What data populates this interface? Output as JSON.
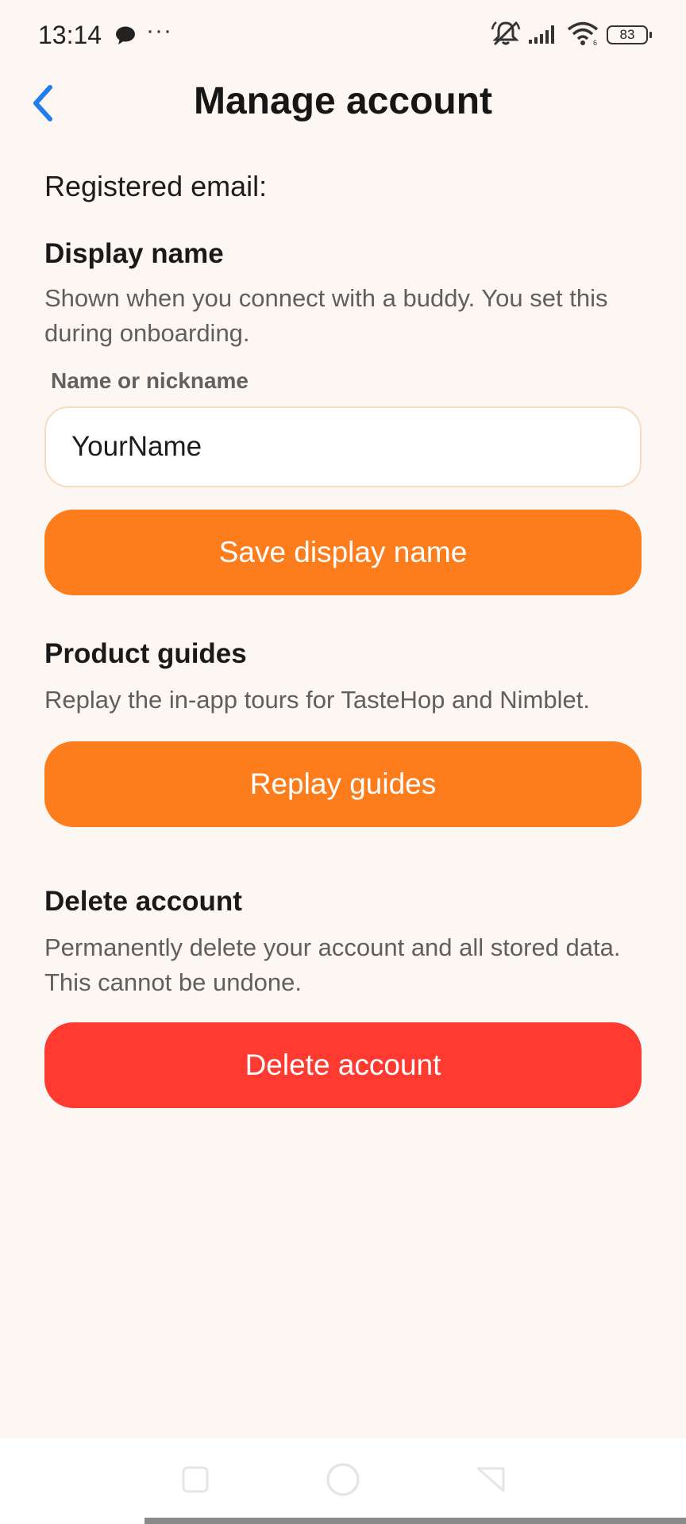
{
  "status_bar": {
    "time": "13:14",
    "dots": "···",
    "battery": "83",
    "icons": [
      "chat-bubble-icon",
      "more-dots-icon",
      "bell-muted-icon",
      "cellular-signal-icon",
      "wifi-icon",
      "battery-icon"
    ]
  },
  "header": {
    "title": "Manage account",
    "back_icon": "chevron-left-icon"
  },
  "account": {
    "registered_email_label": "Registered email:"
  },
  "display_name": {
    "title": "Display name",
    "description": "Shown when you connect with a buddy. You set this during onboarding.",
    "field_label": "Name or nickname",
    "field_value": "YourName",
    "save_button": "Save display name"
  },
  "product_guides": {
    "title": "Product guides",
    "description": "Replay the in-app tours for TasteHop and Nimblet.",
    "button": "Replay guides"
  },
  "delete_account": {
    "title": "Delete account",
    "description": "Permanently delete your account and all stored data. This cannot be undone.",
    "button": "Delete account"
  },
  "colors": {
    "background": "#fdf7f3",
    "accent_orange": "#fd7d1d",
    "danger_red": "#ff3a30",
    "back_blue": "#1e7ef0",
    "input_border": "#f6ddbf"
  },
  "nav_bar": {
    "icons": [
      "recent-apps-icon",
      "home-icon",
      "back-triangle-icon"
    ]
  }
}
